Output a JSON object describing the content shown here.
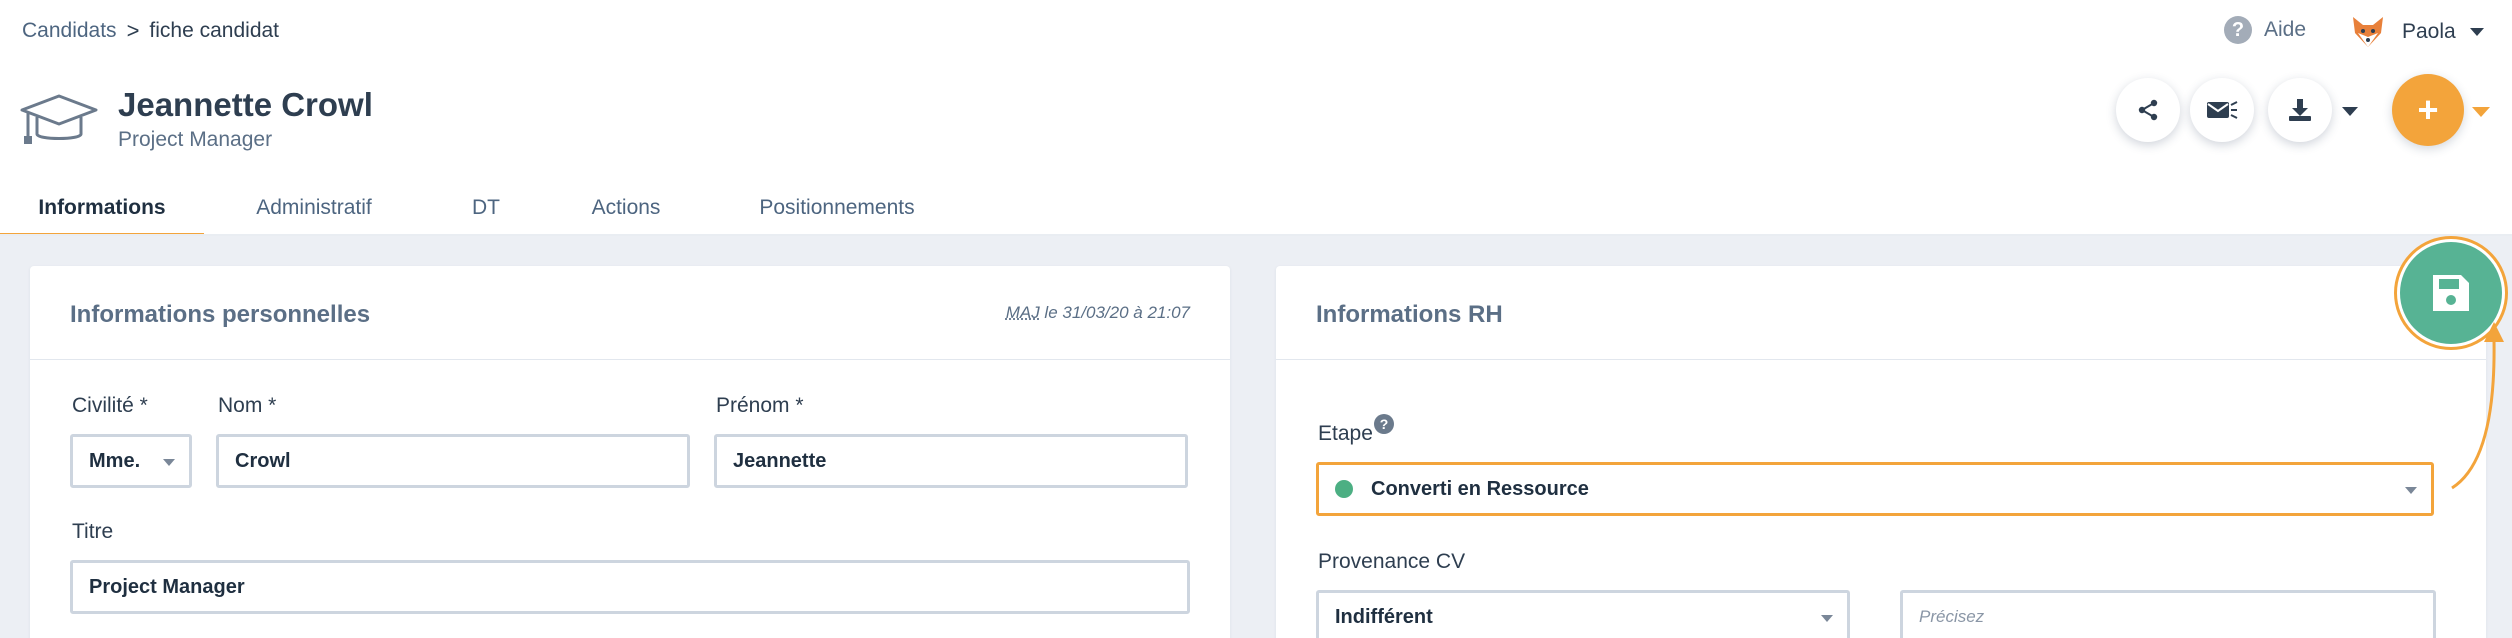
{
  "breadcrumb": {
    "parent": "Candidats",
    "separator": ">",
    "current": "fiche candidat"
  },
  "help": {
    "icon": "question-icon",
    "glyph": "?",
    "label": "Aide"
  },
  "user": {
    "name": "Paola",
    "avatar_icon": "fox-avatar-icon"
  },
  "candidate": {
    "name": "Jeannette Crowl",
    "title": "Project Manager",
    "icon": "graduation-cap-icon"
  },
  "actions": {
    "share_icon": "share-icon",
    "email_icon": "email-send-icon",
    "download_icon": "download-icon",
    "add_label": "+"
  },
  "tabs": [
    {
      "label": "Informations",
      "active": true
    },
    {
      "label": "Administratif",
      "active": false
    },
    {
      "label": "DT",
      "active": false
    },
    {
      "label": "Actions",
      "active": false
    },
    {
      "label": "Positionnements",
      "active": false
    }
  ],
  "personal": {
    "title": "Informations personnelles",
    "meta_prefix": "MAJ",
    "meta_suffix": " le 31/03/20 à 21:07",
    "civilite_label": "Civilité *",
    "civilite_value": "Mme.",
    "nom_label": "Nom *",
    "nom_value": "Crowl",
    "prenom_label": "Prénom *",
    "prenom_value": "Jeannette",
    "titre_label": "Titre",
    "titre_value": "Project Manager"
  },
  "rh": {
    "title": "Informations RH",
    "etape_label": "Etape",
    "etape_help": "?",
    "etape_value": "Converti en Ressource",
    "etape_color": "#4caf83",
    "provenance_label": "Provenance CV",
    "provenance_value": "Indifférent",
    "precisez_placeholder": "Précisez"
  },
  "save": {
    "icon": "floppy-disk-icon"
  },
  "colors": {
    "accent": "#f3a43b",
    "save": "#57b394",
    "text": "#2e3e50",
    "muted": "#5b6f86"
  }
}
